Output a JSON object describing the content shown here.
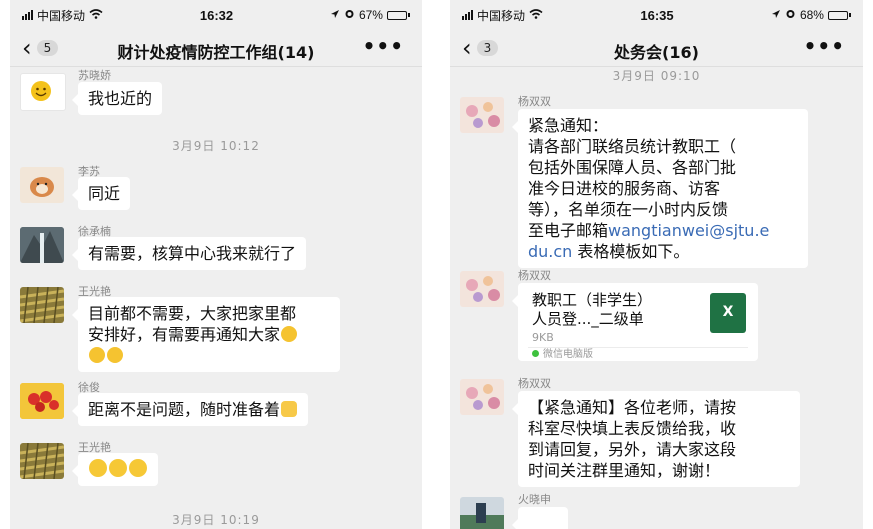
{
  "left_phone": {
    "status": {
      "carrier": "中国移动",
      "time": "16:32",
      "battery": "67%",
      "battery_level": 0.67
    },
    "nav": {
      "back_count": "5",
      "title": "财计处疫情防控工作组(14)",
      "more": "•••"
    },
    "messages": [
      {
        "sender": "苏晓娇",
        "text": "我也近的"
      },
      {
        "timestamp": "3月9日 10:12"
      },
      {
        "sender": "李苏",
        "text": "同近"
      },
      {
        "sender": "徐承楠",
        "text": "有需要，核算中心我来就行了"
      },
      {
        "sender": "王光艳",
        "lines": [
          "目前都不需要，大家把家里都",
          "安排好，有需要再通知大家"
        ]
      },
      {
        "sender": "徐俊",
        "text": "距离不是问题，随时准备着"
      },
      {
        "sender": "王光艳"
      },
      {
        "timestamp": "3月9日 10:19"
      }
    ]
  },
  "right_phone": {
    "status": {
      "carrier": "中国移动",
      "time": "16:35",
      "battery": "68%",
      "battery_level": 0.68
    },
    "nav": {
      "back_count": "3",
      "title": "处务会(16)",
      "more": "•••"
    },
    "timestamp": "3月9日 09:10",
    "messages": [
      {
        "sender": "杨双双",
        "lines": [
          "紧急通知：",
          "请各部门联络员统计教职工（",
          "包括外围保障人员、各部门批",
          "准今日进校的服务商、访客",
          "等），名单须在一小时内反馈"
        ],
        "line6_prefix": "至电子邮箱",
        "email_part1": "wangtianwei@sjtu.e",
        "email_part2": "du.cn",
        "line7_suffix": " 表格模板如下。"
      },
      {
        "sender": "杨双双",
        "file": {
          "name_line1": "教职工（非学生）",
          "name_line2": "人员登..._二级单",
          "size": "9KB",
          "source": "微信电脑版",
          "icon": "X"
        }
      },
      {
        "sender": "杨双双",
        "lines": [
          "【紧急通知】各位老师，请按",
          "科室尽快填上表反馈给我，收",
          "到请回复，另外，请大家这段",
          "时间关注群里通知，谢谢！"
        ]
      },
      {
        "sender": "火晓申"
      }
    ]
  }
}
